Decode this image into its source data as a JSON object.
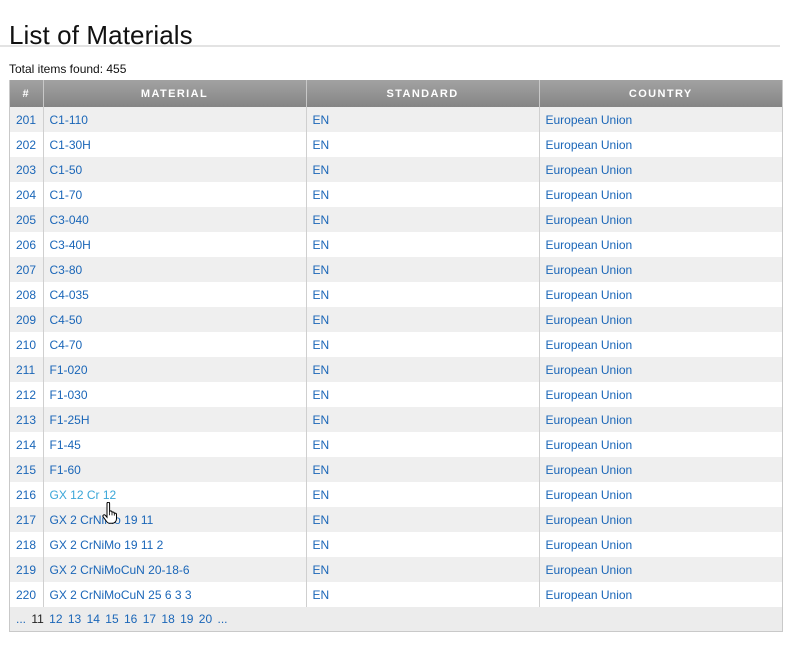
{
  "page": {
    "title": "List of Materials",
    "total_label": "Total items found: 455"
  },
  "table": {
    "columns": [
      "#",
      "MATERIAL",
      "STANDARD",
      "COUNTRY"
    ],
    "rows": [
      {
        "num": "201",
        "material": "C1-110",
        "standard": "EN",
        "country": "European Union"
      },
      {
        "num": "202",
        "material": "C1-30H",
        "standard": "EN",
        "country": "European Union"
      },
      {
        "num": "203",
        "material": "C1-50",
        "standard": "EN",
        "country": "European Union"
      },
      {
        "num": "204",
        "material": "C1-70",
        "standard": "EN",
        "country": "European Union"
      },
      {
        "num": "205",
        "material": "C3-040",
        "standard": "EN",
        "country": "European Union"
      },
      {
        "num": "206",
        "material": "C3-40H",
        "standard": "EN",
        "country": "European Union"
      },
      {
        "num": "207",
        "material": "C3-80",
        "standard": "EN",
        "country": "European Union"
      },
      {
        "num": "208",
        "material": "C4-035",
        "standard": "EN",
        "country": "European Union"
      },
      {
        "num": "209",
        "material": "C4-50",
        "standard": "EN",
        "country": "European Union"
      },
      {
        "num": "210",
        "material": "C4-70",
        "standard": "EN",
        "country": "European Union"
      },
      {
        "num": "211",
        "material": "F1-020",
        "standard": "EN",
        "country": "European Union"
      },
      {
        "num": "212",
        "material": "F1-030",
        "standard": "EN",
        "country": "European Union"
      },
      {
        "num": "213",
        "material": "F1-25H",
        "standard": "EN",
        "country": "European Union"
      },
      {
        "num": "214",
        "material": "F1-45",
        "standard": "EN",
        "country": "European Union"
      },
      {
        "num": "215",
        "material": "F1-60",
        "standard": "EN",
        "country": "European Union"
      },
      {
        "num": "216",
        "material": "GX 12 Cr 12",
        "standard": "EN",
        "country": "European Union"
      },
      {
        "num": "217",
        "material": "GX 2 CrNiMo 19 11",
        "standard": "EN",
        "country": "European Union"
      },
      {
        "num": "218",
        "material": "GX 2 CrNiMo 19 11 2",
        "standard": "EN",
        "country": "European Union"
      },
      {
        "num": "219",
        "material": "GX 2 CrNiMoCuN 20-18-6",
        "standard": "EN",
        "country": "European Union"
      },
      {
        "num": "220",
        "material": "GX 2 CrNiMoCuN 25 6 3 3",
        "standard": "EN",
        "country": "European Union"
      }
    ],
    "hovered_row_index": 15
  },
  "pager": {
    "prev": "...",
    "current": "11",
    "pages": [
      "12",
      "13",
      "14",
      "15",
      "16",
      "17",
      "18",
      "19",
      "20"
    ],
    "next": "..."
  },
  "colors": {
    "link": "#1a66b8",
    "link_hover": "#3aa6d8",
    "header_bg": "#939393",
    "row_alt": "#efefef"
  },
  "icons": {
    "cursor": "hand-pointer-icon"
  }
}
